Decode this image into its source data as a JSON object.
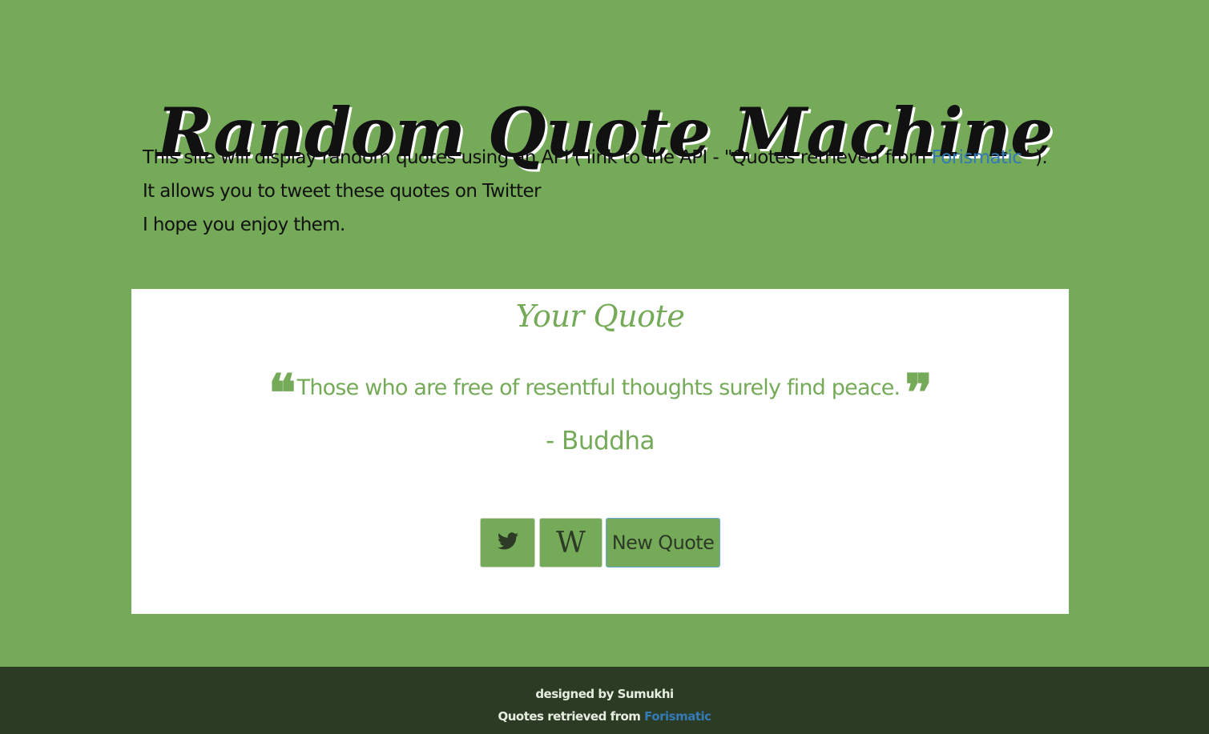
{
  "header": {
    "title": "Random Quote Machine"
  },
  "intro": {
    "text_before_link": "This site will display random quotes using an API ( link to the API - \"Quotes retrieved from ",
    "link_text": "Forismatic",
    "text_after_link": "\" ). It allows you to tweet these quotes on Twitter",
    "line2": "I hope you enjoy them."
  },
  "quote_card": {
    "heading": "Your Quote",
    "open_mark": "❝",
    "close_mark": "❞",
    "quote_text": "Those who are free of resentful thoughts surely find peace.",
    "author": "- Buddha",
    "buttons": {
      "twitter_icon": "twitter-icon",
      "wiki_label": "W",
      "new_quote_label": "New Quote"
    }
  },
  "footer": {
    "designed_by": "designed by Sumukhi",
    "retrieved_prefix": "Quotes retrieved from ",
    "retrieved_link": "Forismatic"
  },
  "colors": {
    "background": "#75aa59",
    "footer_background": "#2c3b24",
    "link": "#337ab7",
    "card": "#ffffff"
  }
}
